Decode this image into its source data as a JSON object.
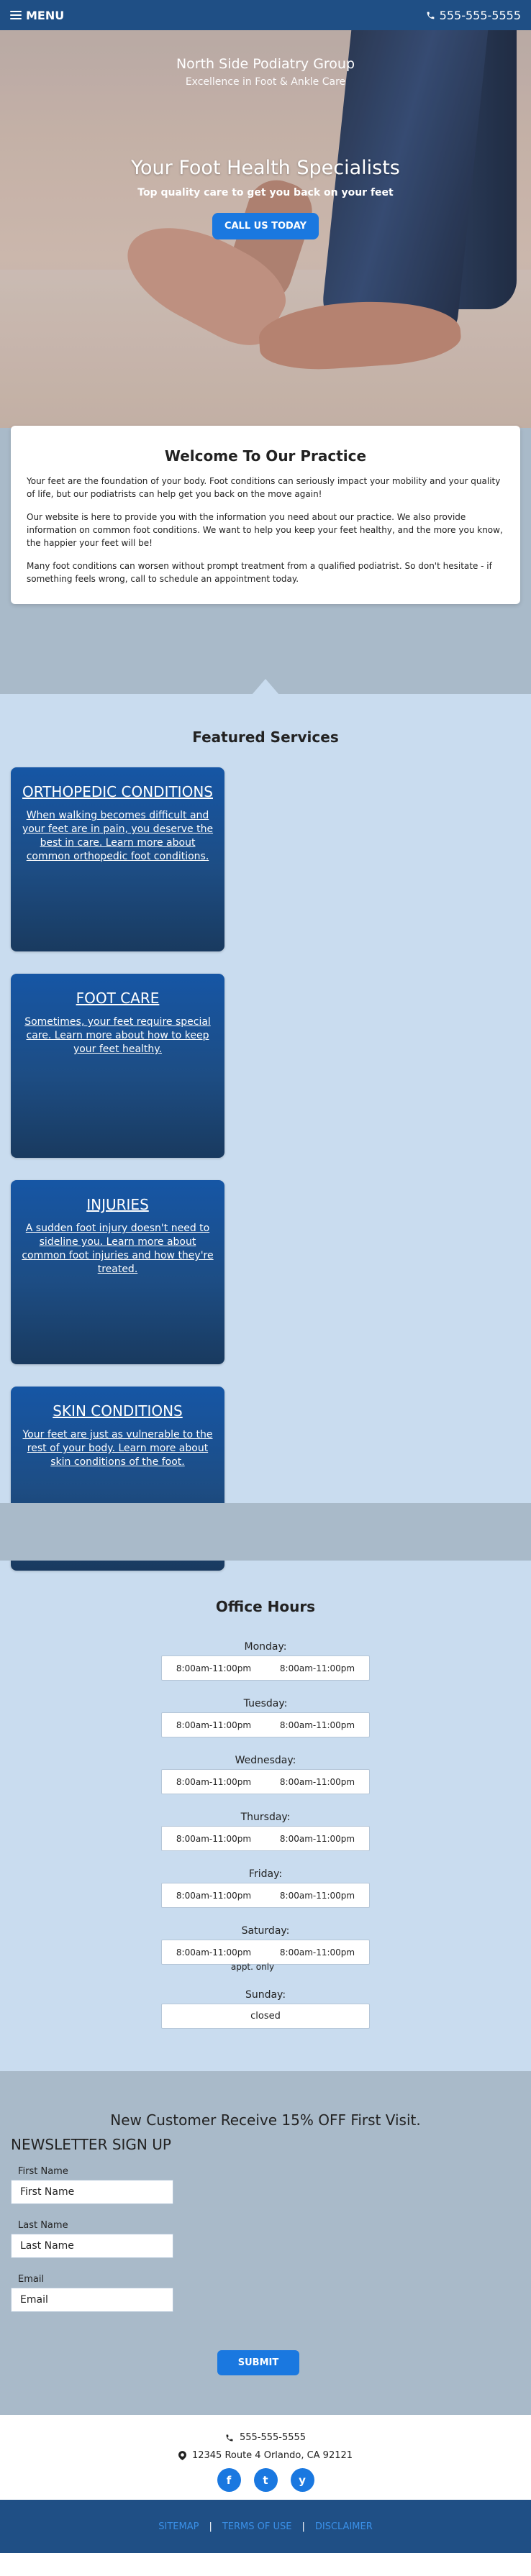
{
  "header": {
    "menu_label": "MENU",
    "phone": "555-555-5555"
  },
  "hero": {
    "practice_name": "North Side Podiatry Group",
    "tagline": "Excellence in Foot & Ankle Care",
    "headline": "Your Foot Health Specialists",
    "subhead": "Top quality care to get you back on your feet",
    "cta_label": "CALL US TODAY"
  },
  "welcome": {
    "title": "Welcome To Our Practice",
    "paragraphs": [
      "Your feet are the foundation of your body. Foot conditions can seriously impact your mobility and your quality of life, but our podiatrists can help get you back on the move again!",
      "Our website is here to provide you with the information you need about our practice. We also provide information on common foot conditions. We want to help you keep your feet healthy, and the more you know, the happier your feet will be!",
      "Many foot conditions can worsen without prompt treatment from a qualified podiatrist. So don't hesitate - if something feels wrong, call to schedule an appointment today."
    ]
  },
  "services": {
    "title": "Featured Services",
    "items": [
      {
        "title": "ORTHOPEDIC CONDITIONS",
        "text": "When walking becomes difficult and your feet are in pain, you deserve the best in care. Learn more about common orthopedic foot conditions."
      },
      {
        "title": "FOOT CARE",
        "text": "Sometimes, your feet require special care. Learn more about how to keep your feet healthy."
      },
      {
        "title": "INJURIES",
        "text": "A sudden foot injury doesn't need to sideline you. Learn more about common foot injuries and how they're treated."
      },
      {
        "title": "SKIN CONDITIONS",
        "text": "Your feet are just as vulnerable to the rest of your body. Learn more about skin conditions of the foot."
      }
    ]
  },
  "hours": {
    "title": "Office Hours",
    "days": [
      {
        "label": "Monday:",
        "open": "8:00am-11:00pm",
        "close": "8:00am-11:00pm"
      },
      {
        "label": "Tuesday:",
        "open": "8:00am-11:00pm",
        "close": "8:00am-11:00pm"
      },
      {
        "label": "Wednesday:",
        "open": "8:00am-11:00pm",
        "close": "8:00am-11:00pm"
      },
      {
        "label": "Thursday:",
        "open": "8:00am-11:00pm",
        "close": "8:00am-11:00pm"
      },
      {
        "label": "Friday:",
        "open": "8:00am-11:00pm",
        "close": "8:00am-11:00pm"
      },
      {
        "label": "Saturday:",
        "open": "8:00am-11:00pm",
        "close": "8:00am-11:00pm",
        "note": "appt. only"
      }
    ],
    "sunday_label": "Sunday:",
    "sunday_value": "closed"
  },
  "newsletter": {
    "offer": "New Customer Receive 15% OFF First Visit.",
    "title": "NEWSLETTER SIGN UP",
    "fields": [
      {
        "label": "First Name",
        "placeholder": "First Name"
      },
      {
        "label": "Last Name",
        "placeholder": "Last Name"
      },
      {
        "label": "Email",
        "placeholder": "Email"
      }
    ],
    "submit_label": "SUBMIT"
  },
  "footer": {
    "phone": "555-555-5555",
    "address": "12345 Route 4 Orlando, CA 92121",
    "social": [
      "f",
      "t",
      "y"
    ],
    "links": [
      "SITEMAP",
      "TERMS OF USE",
      "DISCLAIMER"
    ],
    "separator": "|"
  },
  "colors": {
    "navy": "#1f4f85",
    "accent": "#1a78e0",
    "light_blue": "#c9dcef",
    "gray_blue": "#a9bac9"
  }
}
